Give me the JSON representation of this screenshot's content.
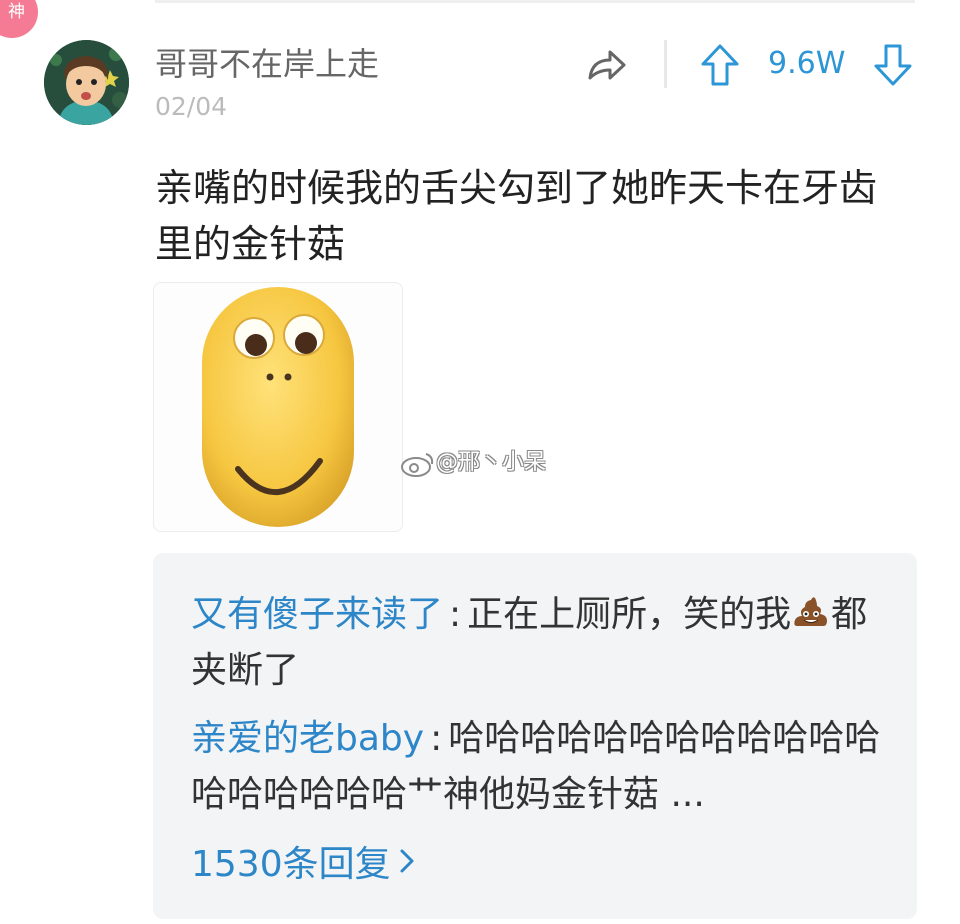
{
  "badge": {
    "label": "神"
  },
  "post": {
    "username": "哥哥不在岸上走",
    "date": "02/04",
    "vote_count": "9.6W",
    "text": "亲嘴的时候我的舌尖勾到了她昨天卡在牙齿\n里的金针菇"
  },
  "image": {
    "watermark": "@邢丶小呆"
  },
  "comments": [
    {
      "author": "又有傻子来读了",
      "separator": ":",
      "text_before_icon": "正在上厕所，笑的我",
      "icon": "poop-emoji-icon",
      "text_after_icon": "都夹断了"
    },
    {
      "author": "亲爱的老baby",
      "separator": ":",
      "text": "哈哈哈哈哈哈哈哈哈哈哈哈哈哈哈哈哈哈艹神他妈金针菇 ..."
    }
  ],
  "replies": {
    "label": "1530条回复"
  },
  "colors": {
    "accent": "#2c86c8",
    "badge": "#f47b93",
    "panel": "#f3f4f6"
  }
}
